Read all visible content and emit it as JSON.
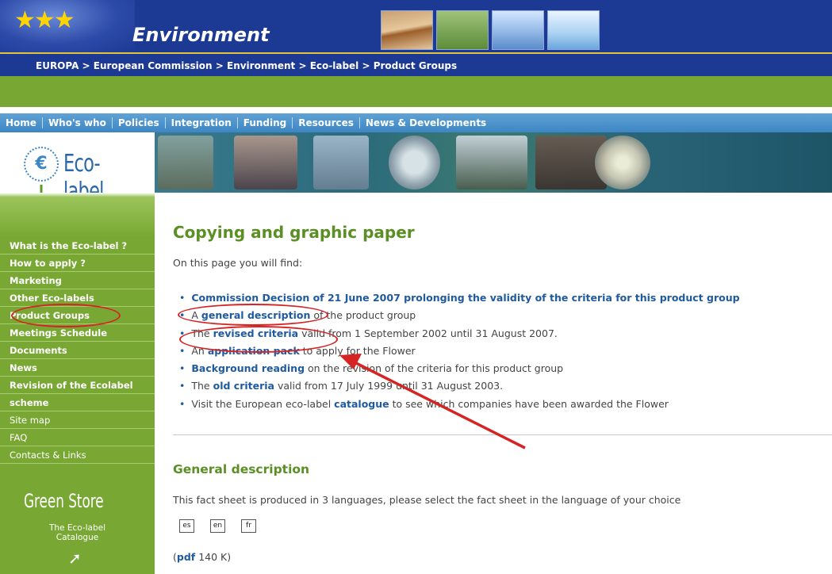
{
  "header": {
    "title": "Environment",
    "breadcrumb": "EUROPA > European Commission > Environment > Eco-label > Product Groups"
  },
  "nav": [
    {
      "label": "Home"
    },
    {
      "label": "Who's who"
    },
    {
      "label": "Policies"
    },
    {
      "label": "Integration"
    },
    {
      "label": "Funding"
    },
    {
      "label": "Resources"
    },
    {
      "label": "News & Developments"
    }
  ],
  "logo": {
    "text": "Eco-label"
  },
  "sidebar": {
    "items": [
      {
        "label": "What is the Eco-label ?"
      },
      {
        "label": "How to apply ?"
      },
      {
        "label": "Marketing"
      },
      {
        "label": "Other Eco-labels"
      },
      {
        "label": "Product Groups"
      },
      {
        "label": "Meetings Schedule"
      },
      {
        "label": "Documents"
      },
      {
        "label": "News"
      },
      {
        "label": "Revision of the Ecolabel"
      },
      {
        "label": "scheme"
      },
      {
        "label": "Site map"
      },
      {
        "label": "FAQ"
      },
      {
        "label": "Contacts & Links"
      }
    ],
    "greenstore": {
      "title": "Green Store",
      "subtitle_line1": "The Eco-label",
      "subtitle_line2": "Catalogue"
    }
  },
  "main": {
    "title": "Copying and graphic paper",
    "intro": "On this page you will find:",
    "links": [
      {
        "pre": "",
        "link": "Commission Decision of 21 June 2007 prolonging the validity of the criteria for this product group",
        "post": ""
      },
      {
        "pre": "A ",
        "link": "general description",
        "post": " of the product group"
      },
      {
        "pre": "The ",
        "link": "revised criteria",
        "post": " valid from 1 September 2002 until 31 August 2007."
      },
      {
        "pre": "An ",
        "link": "application pack",
        "post": " to apply for the Flower"
      },
      {
        "pre": "",
        "link": "Background reading",
        "post": " on the revision of the criteria for this product group"
      },
      {
        "pre": "The ",
        "link": "old criteria",
        "post": " valid from 17 July 1999 until 31 August 2003."
      },
      {
        "pre": "Visit the European eco-label ",
        "link": "catalogue",
        "post": " to see which companies have been awarded the Flower"
      }
    ],
    "section_title": "General description",
    "section_text": "This fact sheet is produced in 3 languages, please select the fact sheet in the language of your choice",
    "languages": [
      "es",
      "en",
      "fr"
    ],
    "pdf_link": "pdf",
    "pdf_size": " 140 K",
    "pdf_open": "(",
    "pdf_close": ")"
  },
  "colors": {
    "header_blue": "#1c3a93",
    "green": "#78a833",
    "link_blue": "#1f5aa0",
    "annotation_red": "#d42424"
  }
}
